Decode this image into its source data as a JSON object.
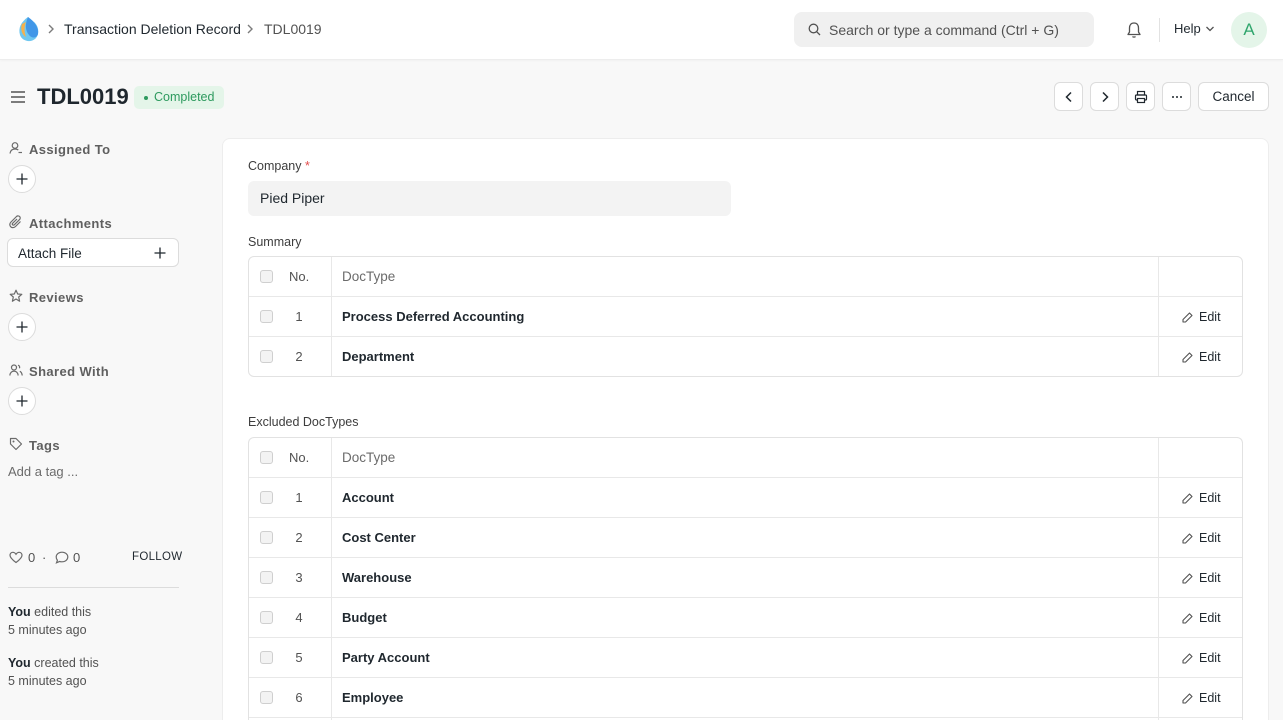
{
  "navbar": {
    "breadcrumbs": [
      "Transaction Deletion Record",
      "TDL0019"
    ],
    "search_placeholder": "Search or type a command (Ctrl + G)",
    "help_label": "Help",
    "avatar_initial": "A"
  },
  "header": {
    "title": "TDL0019",
    "status": "Completed",
    "cancel_label": "Cancel"
  },
  "sidebar": {
    "assigned_to": "Assigned To",
    "attachments": "Attachments",
    "attach_file": "Attach File",
    "reviews": "Reviews",
    "shared_with": "Shared With",
    "tags": "Tags",
    "add_tag": "Add a tag ...",
    "likes": "0",
    "comments": "0",
    "follow": "FOLLOW",
    "activity": [
      {
        "who": "You",
        "action": "edited this",
        "when": "5 minutes ago"
      },
      {
        "who": "You",
        "action": "created this",
        "when": "5 minutes ago"
      }
    ]
  },
  "form": {
    "company_label": "Company",
    "company_value": "Pied Piper",
    "summary_label": "Summary",
    "excluded_label": "Excluded DocTypes",
    "col_no": "No.",
    "col_doctype": "DocType",
    "edit_label": "Edit",
    "summary_rows": [
      {
        "no": "1",
        "doctype": "Process Deferred Accounting"
      },
      {
        "no": "2",
        "doctype": "Department"
      }
    ],
    "excluded_rows": [
      {
        "no": "1",
        "doctype": "Account"
      },
      {
        "no": "2",
        "doctype": "Cost Center"
      },
      {
        "no": "3",
        "doctype": "Warehouse"
      },
      {
        "no": "4",
        "doctype": "Budget"
      },
      {
        "no": "5",
        "doctype": "Party Account"
      },
      {
        "no": "6",
        "doctype": "Employee"
      }
    ]
  },
  "colors": {
    "status_bg": "#e4f5e9",
    "status_text": "#2d9a5e",
    "required": "#e24c4c"
  }
}
